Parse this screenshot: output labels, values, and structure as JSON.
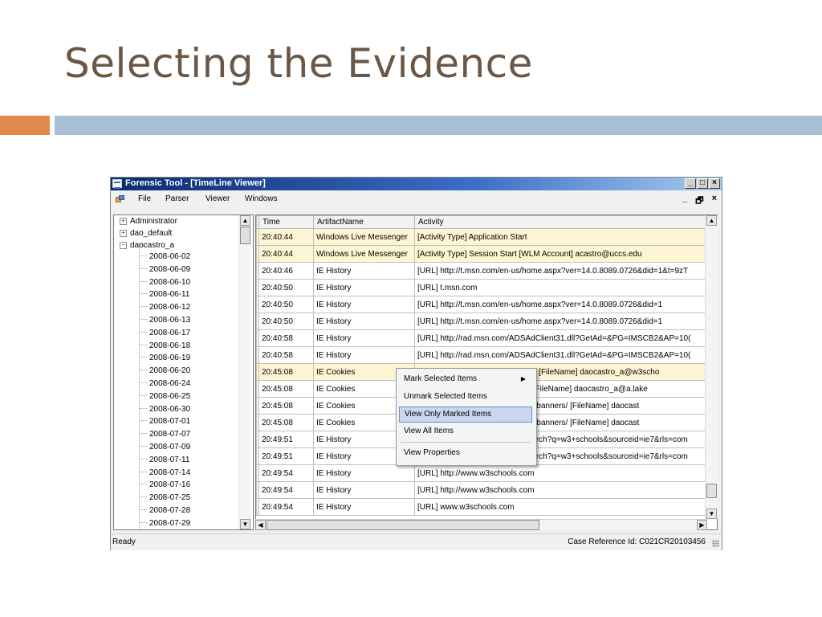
{
  "slide": {
    "title": "Selecting the Evidence"
  },
  "window": {
    "title": "Forensic Tool - [TimeLine Viewer]",
    "controls": {
      "minimize": "_",
      "maximize": "□",
      "close": "×"
    },
    "mdi_controls": {
      "minimize": "_",
      "restore": "🗗",
      "close": "×"
    }
  },
  "menu": {
    "items": [
      "File",
      "Parser",
      "Viewer",
      "Windows"
    ]
  },
  "tree": {
    "nodes": [
      {
        "label": "Administrator",
        "expander": "+"
      },
      {
        "label": "dao_default",
        "expander": "+"
      },
      {
        "label": "daocastro_a",
        "expander": "−"
      }
    ],
    "dates": [
      "2008-06-02",
      "2008-06-09",
      "2008-06-10",
      "2008-06-11",
      "2008-06-12",
      "2008-06-13",
      "2008-06-17",
      "2008-06-18",
      "2008-06-19",
      "2008-06-20",
      "2008-06-24",
      "2008-06-25",
      "2008-06-30",
      "2008-07-01",
      "2008-07-07",
      "2008-07-09",
      "2008-07-11",
      "2008-07-14",
      "2008-07-16",
      "2008-07-25",
      "2008-07-28",
      "2008-07-29"
    ]
  },
  "grid": {
    "columns": [
      "Time",
      "ArtifactName",
      "Activity"
    ],
    "rows": [
      {
        "time": "20:40:44",
        "artifact": "Windows Live Messenger",
        "activity": "[Activity Type] Application Start",
        "marked": true
      },
      {
        "time": "20:40:44",
        "artifact": "Windows Live Messenger",
        "activity": "[Activity Type] Session Start [WLM Account] acastro@uccs.edu",
        "marked": true
      },
      {
        "time": "20:40:46",
        "artifact": "IE History",
        "activity": "[URL] http://t.msn.com/en-us/home.aspx?ver=14.0.8089.0726&did=1&t=9zT",
        "marked": false
      },
      {
        "time": "20:40:50",
        "artifact": "IE History",
        "activity": "[URL] t.msn.com",
        "marked": false
      },
      {
        "time": "20:40:50",
        "artifact": "IE History",
        "activity": "[URL] http://t.msn.com/en-us/home.aspx?ver=14.0.8089.0726&did=1",
        "marked": false
      },
      {
        "time": "20:40:50",
        "artifact": "IE History",
        "activity": "[URL] http://t.msn.com/en-us/home.aspx?ver=14.0.8089.0726&did=1",
        "marked": false
      },
      {
        "time": "20:40:58",
        "artifact": "IE History",
        "activity": "[URL] http://rad.msn.com/ADSAdClient31.dll?GetAd=&PG=IMSCB2&AP=10(",
        "marked": false
      },
      {
        "time": "20:40:58",
        "artifact": "IE History",
        "activity": "[URL] http://rad.msn.com/ADSAdClient31.dll?GetAd=&PG=IMSCB2&AP=10(",
        "marked": false
      },
      {
        "time": "20:45:08",
        "artifact": "IE Cookies",
        "activity": "[URL] http://www.w3schools.com/ [FileName] daocastro_a@w3scho",
        "marked": true
      },
      {
        "time": "20:45:08",
        "artifact": "IE Cookies",
        "activity": "[URL] http://www.adquincy.com/ [FileName] daocastro_a@a.lake",
        "marked": false
      },
      {
        "time": "20:45:08",
        "artifact": "IE Cookies",
        "activity": "[URL] http://www.w3schools.com/banners/ [FileName] daocast",
        "marked": false
      },
      {
        "time": "20:45:08",
        "artifact": "IE Cookies",
        "activity": "[URL] http://www.w3schools.com/banners/ [FileName] daocast",
        "marked": false
      },
      {
        "time": "20:49:51",
        "artifact": "IE History",
        "activity": "[URL] http://www.google.com/search?q=w3+schools&sourceid=ie7&rls=com",
        "marked": false
      },
      {
        "time": "20:49:51",
        "artifact": "IE History",
        "activity": "[URL] http://www.google.com/search?q=w3+schools&sourceid=ie7&rls=com",
        "marked": false
      },
      {
        "time": "20:49:54",
        "artifact": "IE History",
        "activity": "[URL] http://www.w3schools.com",
        "marked": false
      },
      {
        "time": "20:49:54",
        "artifact": "IE History",
        "activity": "[URL] http://www.w3schools.com",
        "marked": false
      },
      {
        "time": "20:49:54",
        "artifact": "IE History",
        "activity": "[URL] www.w3schools.com",
        "marked": false
      }
    ]
  },
  "context_menu": {
    "items": [
      "Mark Selected Items",
      "Unmark Selected Items",
      "View Only Marked Items",
      "View All Items",
      "View Properties"
    ],
    "submenu_arrow": "▶"
  },
  "status": {
    "left": "Ready",
    "right": "Case Reference Id: C021CR20103456"
  },
  "scroll": {
    "up": "▲",
    "down": "▼",
    "left": "◀",
    "right": "▶"
  }
}
